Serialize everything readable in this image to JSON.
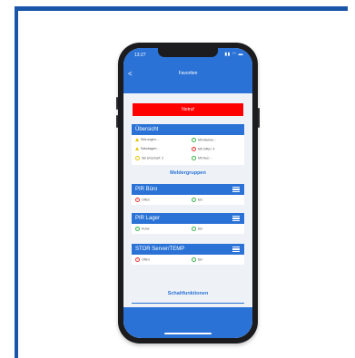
{
  "status": {
    "time": "13:27",
    "icons": "▮▮ ◠ ▬"
  },
  "nav": {
    "title": "Favoriten",
    "back": "<"
  },
  "notruf": {
    "label": "Notruf"
  },
  "uebersicht": {
    "title": "Übersicht",
    "items": [
      [
        "Störungen: -",
        "Mit Alarme: -"
      ],
      [
        "Sabotagen: -",
        "Mit Offen: 4"
      ],
      [
        "SB Unscharf: 2",
        "Mit Aus: -"
      ]
    ]
  },
  "meldergruppen": {
    "title": "Meldergruppen",
    "groups": [
      {
        "name": "PIR Büro",
        "state": "Offen",
        "mode": "Ein"
      },
      {
        "name": "PIR Lager",
        "state": "Ruhe",
        "mode": "Ein"
      },
      {
        "name": "STOR Server/TEMP",
        "state": "Offen",
        "mode": "Ein"
      }
    ]
  },
  "schaltfunktionen": {
    "title": "Schaltfunktionen"
  },
  "colors": {
    "primary": "#2a72d6",
    "notruf": "#ff0000",
    "frame": "#1a56a8"
  }
}
